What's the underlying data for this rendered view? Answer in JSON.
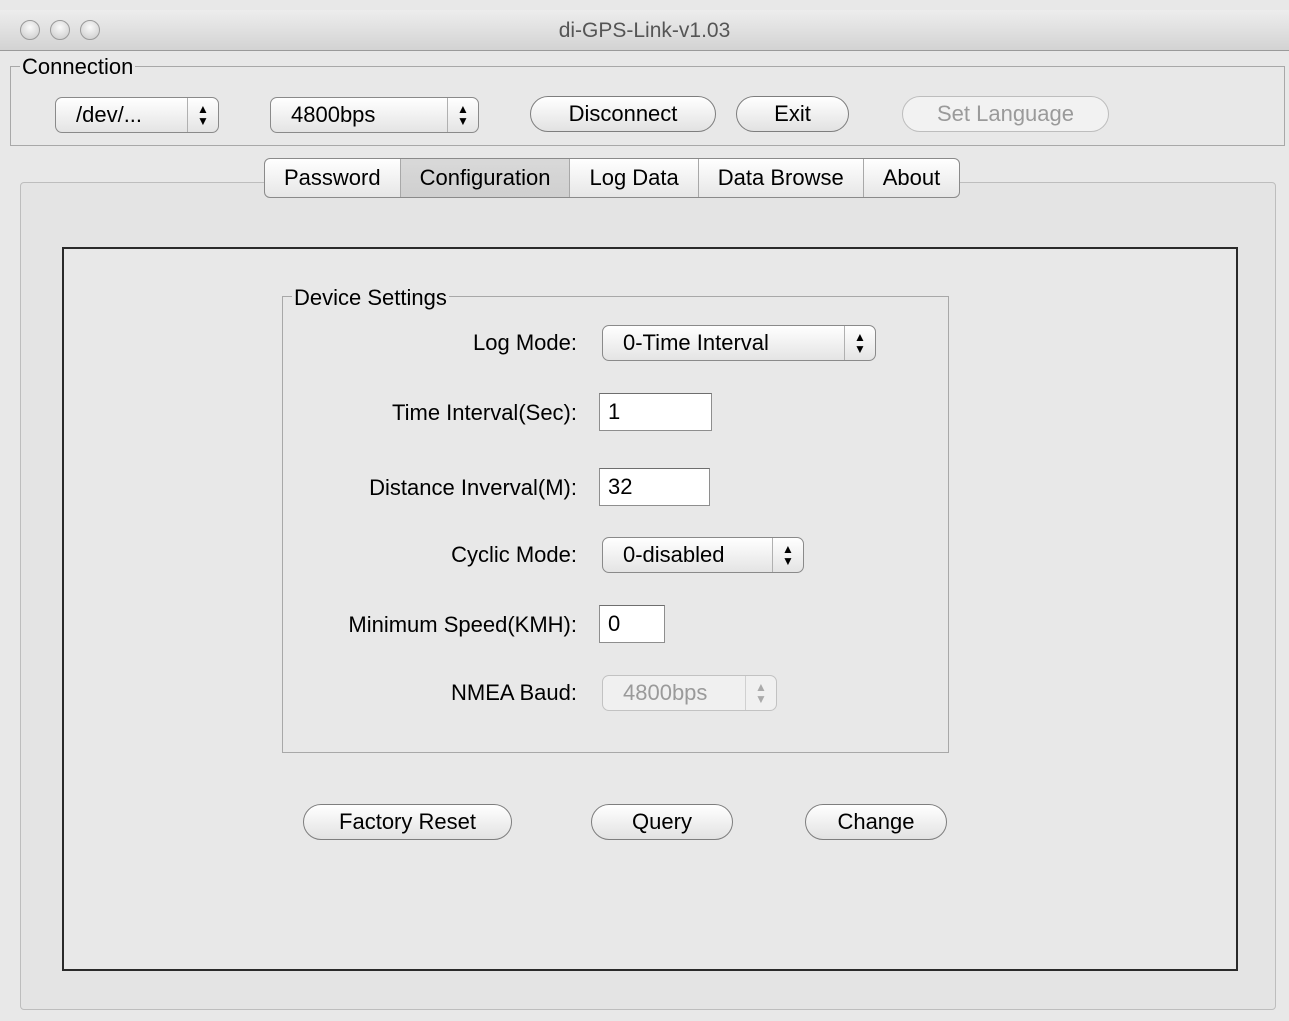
{
  "window": {
    "title": "di-GPS-Link-v1.03"
  },
  "connection": {
    "group_label": "Connection",
    "port_select": "/dev/...",
    "baud_select": "4800bps",
    "disconnect_label": "Disconnect",
    "exit_label": "Exit",
    "set_language_label": "Set Language"
  },
  "tabs": [
    {
      "label": "Password"
    },
    {
      "label": "Configuration",
      "selected": true
    },
    {
      "label": "Log Data"
    },
    {
      "label": "Data Browse"
    },
    {
      "label": "About"
    }
  ],
  "device_settings": {
    "group_label": "Device Settings",
    "log_mode": {
      "label": "Log Mode:",
      "value": "0-Time Interval"
    },
    "time_interval": {
      "label": "Time Interval(Sec):",
      "value": "1"
    },
    "distance_interval": {
      "label": "Distance Inverval(M):",
      "value": "32"
    },
    "cyclic_mode": {
      "label": "Cyclic Mode:",
      "value": "0-disabled"
    },
    "minimum_speed": {
      "label": "Minimum Speed(KMH):",
      "value": "0"
    },
    "nmea_baud": {
      "label": "NMEA Baud:",
      "value": "4800bps"
    }
  },
  "actions": {
    "factory_reset_label": "Factory Reset",
    "query_label": "Query",
    "change_label": "Change"
  },
  "icons": {
    "popup_arrows": "up-down-arrows-icon",
    "window_buttons": [
      "close-icon",
      "minimize-icon",
      "zoom-icon"
    ]
  }
}
